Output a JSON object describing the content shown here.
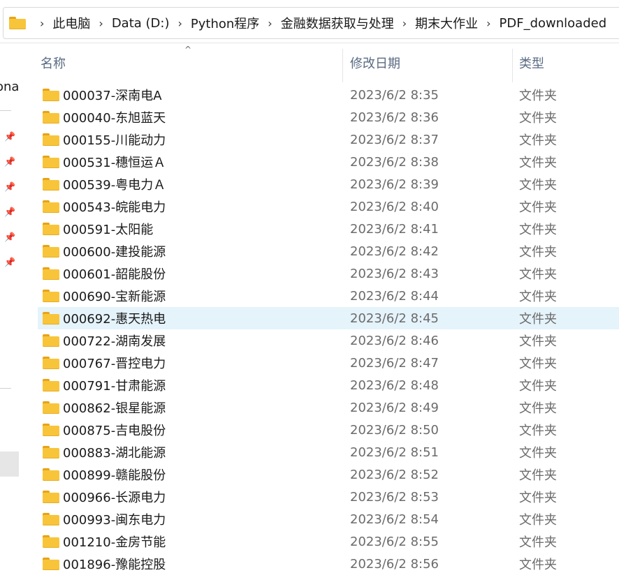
{
  "addressbar": {
    "crumbs": [
      "此电脑",
      "Data (D:)",
      "Python程序",
      "金融数据获取与处理",
      "期末大作业",
      "PDF_downloaded"
    ]
  },
  "leftnav": {
    "partial_text": "ona"
  },
  "columns": {
    "name": "名称",
    "date": "修改日期",
    "type": "类型"
  },
  "rows": [
    {
      "name": "000037-深南电A",
      "date": "2023/6/2 8:35",
      "type": "文件夹"
    },
    {
      "name": "000040-东旭蓝天",
      "date": "2023/6/2 8:36",
      "type": "文件夹"
    },
    {
      "name": "000155-川能动力",
      "date": "2023/6/2 8:37",
      "type": "文件夹"
    },
    {
      "name": "000531-穗恒运Ａ",
      "date": "2023/6/2 8:38",
      "type": "文件夹"
    },
    {
      "name": "000539-粤电力Ａ",
      "date": "2023/6/2 8:39",
      "type": "文件夹"
    },
    {
      "name": "000543-皖能电力",
      "date": "2023/6/2 8:40",
      "type": "文件夹"
    },
    {
      "name": "000591-太阳能",
      "date": "2023/6/2 8:41",
      "type": "文件夹"
    },
    {
      "name": "000600-建投能源",
      "date": "2023/6/2 8:42",
      "type": "文件夹"
    },
    {
      "name": "000601-韶能股份",
      "date": "2023/6/2 8:43",
      "type": "文件夹"
    },
    {
      "name": "000690-宝新能源",
      "date": "2023/6/2 8:44",
      "type": "文件夹"
    },
    {
      "name": "000692-惠天热电",
      "date": "2023/6/2 8:45",
      "type": "文件夹",
      "selected": true
    },
    {
      "name": "000722-湖南发展",
      "date": "2023/6/2 8:46",
      "type": "文件夹"
    },
    {
      "name": "000767-晋控电力",
      "date": "2023/6/2 8:47",
      "type": "文件夹"
    },
    {
      "name": "000791-甘肃能源",
      "date": "2023/6/2 8:48",
      "type": "文件夹"
    },
    {
      "name": "000862-银星能源",
      "date": "2023/6/2 8:49",
      "type": "文件夹"
    },
    {
      "name": "000875-吉电股份",
      "date": "2023/6/2 8:50",
      "type": "文件夹"
    },
    {
      "name": "000883-湖北能源",
      "date": "2023/6/2 8:51",
      "type": "文件夹"
    },
    {
      "name": "000899-赣能股份",
      "date": "2023/6/2 8:52",
      "type": "文件夹"
    },
    {
      "name": "000966-长源电力",
      "date": "2023/6/2 8:53",
      "type": "文件夹"
    },
    {
      "name": "000993-闽东电力",
      "date": "2023/6/2 8:54",
      "type": "文件夹"
    },
    {
      "name": "001210-金房节能",
      "date": "2023/6/2 8:55",
      "type": "文件夹"
    },
    {
      "name": "001896-豫能控股",
      "date": "2023/6/2 8:56",
      "type": "文件夹"
    }
  ],
  "colors": {
    "folder": "#f8c53a",
    "selected_row": "#e5f3fb",
    "header_text": "#5a6b82"
  }
}
